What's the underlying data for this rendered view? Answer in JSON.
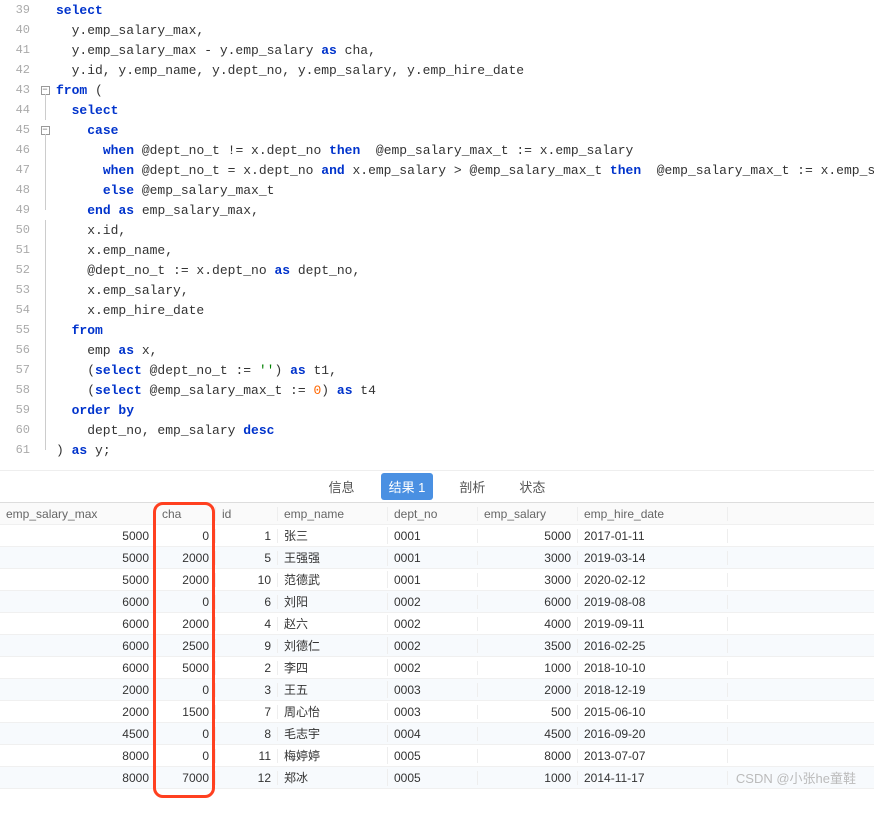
{
  "code": {
    "lines": [
      {
        "n": 39,
        "fold": "",
        "tokens": [
          {
            "t": "select",
            "c": "kw"
          }
        ]
      },
      {
        "n": 40,
        "fold": "",
        "tokens": [
          {
            "t": "  y.emp_salary_max,",
            "c": "var"
          }
        ]
      },
      {
        "n": 41,
        "fold": "",
        "tokens": [
          {
            "t": "  y.emp_salary_max - y.emp_salary ",
            "c": "var"
          },
          {
            "t": "as",
            "c": "kw"
          },
          {
            "t": " cha,",
            "c": "var"
          }
        ]
      },
      {
        "n": 42,
        "fold": "",
        "tokens": [
          {
            "t": "  y.id, y.emp_name, y.dept_no, y.emp_salary, y.emp_hire_date",
            "c": "var"
          }
        ]
      },
      {
        "n": 43,
        "fold": "box",
        "tokens": [
          {
            "t": "from",
            "c": "kw"
          },
          {
            "t": " (",
            "c": "op"
          }
        ]
      },
      {
        "n": 44,
        "fold": "line",
        "tokens": [
          {
            "t": "  ",
            "c": "var"
          },
          {
            "t": "select",
            "c": "kw"
          }
        ]
      },
      {
        "n": 45,
        "fold": "box",
        "tokens": [
          {
            "t": "    ",
            "c": "var"
          },
          {
            "t": "case",
            "c": "kw"
          }
        ]
      },
      {
        "n": 46,
        "fold": "line",
        "tokens": [
          {
            "t": "      ",
            "c": "var"
          },
          {
            "t": "when",
            "c": "kw"
          },
          {
            "t": " @dept_no_t != x.dept_no ",
            "c": "var"
          },
          {
            "t": "then",
            "c": "kw"
          },
          {
            "t": "  @emp_salary_max_t := x.emp_salary",
            "c": "var"
          }
        ]
      },
      {
        "n": 47,
        "fold": "line",
        "tokens": [
          {
            "t": "      ",
            "c": "var"
          },
          {
            "t": "when",
            "c": "kw"
          },
          {
            "t": " @dept_no_t = x.dept_no ",
            "c": "var"
          },
          {
            "t": "and",
            "c": "kw"
          },
          {
            "t": " x.emp_salary > @emp_salary_max_t ",
            "c": "var"
          },
          {
            "t": "then",
            "c": "kw"
          },
          {
            "t": "  @emp_salary_max_t := x.emp_salary",
            "c": "var"
          }
        ]
      },
      {
        "n": 48,
        "fold": "line",
        "tokens": [
          {
            "t": "      ",
            "c": "var"
          },
          {
            "t": "else",
            "c": "kw"
          },
          {
            "t": " @emp_salary_max_t",
            "c": "var"
          }
        ]
      },
      {
        "n": 49,
        "fold": "end",
        "tokens": [
          {
            "t": "    ",
            "c": "var"
          },
          {
            "t": "end",
            "c": "kw"
          },
          {
            "t": " ",
            "c": "var"
          },
          {
            "t": "as",
            "c": "kw"
          },
          {
            "t": " emp_salary_max,",
            "c": "var"
          }
        ]
      },
      {
        "n": 50,
        "fold": "line",
        "tokens": [
          {
            "t": "    x.id,",
            "c": "var"
          }
        ]
      },
      {
        "n": 51,
        "fold": "line",
        "tokens": [
          {
            "t": "    x.emp_name,",
            "c": "var"
          }
        ]
      },
      {
        "n": 52,
        "fold": "line",
        "tokens": [
          {
            "t": "    @dept_no_t := x.dept_no ",
            "c": "var"
          },
          {
            "t": "as",
            "c": "kw"
          },
          {
            "t": " dept_no,",
            "c": "var"
          }
        ]
      },
      {
        "n": 53,
        "fold": "line",
        "tokens": [
          {
            "t": "    x.emp_salary,",
            "c": "var"
          }
        ]
      },
      {
        "n": 54,
        "fold": "line",
        "tokens": [
          {
            "t": "    x.emp_hire_date",
            "c": "var"
          }
        ]
      },
      {
        "n": 55,
        "fold": "line",
        "tokens": [
          {
            "t": "  ",
            "c": "var"
          },
          {
            "t": "from",
            "c": "kw"
          }
        ]
      },
      {
        "n": 56,
        "fold": "line",
        "tokens": [
          {
            "t": "    emp ",
            "c": "var"
          },
          {
            "t": "as",
            "c": "kw"
          },
          {
            "t": " x,",
            "c": "var"
          }
        ]
      },
      {
        "n": 57,
        "fold": "line",
        "tokens": [
          {
            "t": "    (",
            "c": "op"
          },
          {
            "t": "select",
            "c": "kw"
          },
          {
            "t": " @dept_no_t := ",
            "c": "var"
          },
          {
            "t": "''",
            "c": "str"
          },
          {
            "t": ") ",
            "c": "op"
          },
          {
            "t": "as",
            "c": "kw"
          },
          {
            "t": " t1,",
            "c": "var"
          }
        ]
      },
      {
        "n": 58,
        "fold": "line",
        "tokens": [
          {
            "t": "    (",
            "c": "op"
          },
          {
            "t": "select",
            "c": "kw"
          },
          {
            "t": " @emp_salary_max_t := ",
            "c": "var"
          },
          {
            "t": "0",
            "c": "num"
          },
          {
            "t": ") ",
            "c": "op"
          },
          {
            "t": "as",
            "c": "kw"
          },
          {
            "t": " t4",
            "c": "var"
          }
        ]
      },
      {
        "n": 59,
        "fold": "line",
        "tokens": [
          {
            "t": "  ",
            "c": "var"
          },
          {
            "t": "order by",
            "c": "kw"
          }
        ]
      },
      {
        "n": 60,
        "fold": "line",
        "tokens": [
          {
            "t": "    dept_no, emp_salary ",
            "c": "var"
          },
          {
            "t": "desc",
            "c": "kw"
          }
        ]
      },
      {
        "n": 61,
        "fold": "end",
        "tokens": [
          {
            "t": ") ",
            "c": "op"
          },
          {
            "t": "as",
            "c": "kw"
          },
          {
            "t": " y;",
            "c": "var"
          }
        ]
      }
    ]
  },
  "tabs": {
    "info": "信息",
    "result": "结果 1",
    "profile": "剖析",
    "status": "状态"
  },
  "table": {
    "headers": {
      "max": "emp_salary_max",
      "cha": "cha",
      "id": "id",
      "name": "emp_name",
      "dept": "dept_no",
      "sal": "emp_salary",
      "hire": "emp_hire_date"
    },
    "rows": [
      {
        "max": "5000",
        "cha": "0",
        "id": "1",
        "name": "张三",
        "dept": "0001",
        "sal": "5000",
        "hire": "2017-01-11"
      },
      {
        "max": "5000",
        "cha": "2000",
        "id": "5",
        "name": "王强强",
        "dept": "0001",
        "sal": "3000",
        "hire": "2019-03-14"
      },
      {
        "max": "5000",
        "cha": "2000",
        "id": "10",
        "name": "范德武",
        "dept": "0001",
        "sal": "3000",
        "hire": "2020-02-12"
      },
      {
        "max": "6000",
        "cha": "0",
        "id": "6",
        "name": "刘阳",
        "dept": "0002",
        "sal": "6000",
        "hire": "2019-08-08"
      },
      {
        "max": "6000",
        "cha": "2000",
        "id": "4",
        "name": "赵六",
        "dept": "0002",
        "sal": "4000",
        "hire": "2019-09-11"
      },
      {
        "max": "6000",
        "cha": "2500",
        "id": "9",
        "name": "刘德仁",
        "dept": "0002",
        "sal": "3500",
        "hire": "2016-02-25"
      },
      {
        "max": "6000",
        "cha": "5000",
        "id": "2",
        "name": "李四",
        "dept": "0002",
        "sal": "1000",
        "hire": "2018-10-10"
      },
      {
        "max": "2000",
        "cha": "0",
        "id": "3",
        "name": "王五",
        "dept": "0003",
        "sal": "2000",
        "hire": "2018-12-19"
      },
      {
        "max": "2000",
        "cha": "1500",
        "id": "7",
        "name": "周心怡",
        "dept": "0003",
        "sal": "500",
        "hire": "2015-06-10"
      },
      {
        "max": "4500",
        "cha": "0",
        "id": "8",
        "name": "毛志宇",
        "dept": "0004",
        "sal": "4500",
        "hire": "2016-09-20"
      },
      {
        "max": "8000",
        "cha": "0",
        "id": "11",
        "name": "梅婷婷",
        "dept": "0005",
        "sal": "8000",
        "hire": "2013-07-07"
      },
      {
        "max": "8000",
        "cha": "7000",
        "id": "12",
        "name": "郑冰",
        "dept": "0005",
        "sal": "1000",
        "hire": "2014-11-17"
      }
    ]
  },
  "watermark": "CSDN @小张he童鞋"
}
